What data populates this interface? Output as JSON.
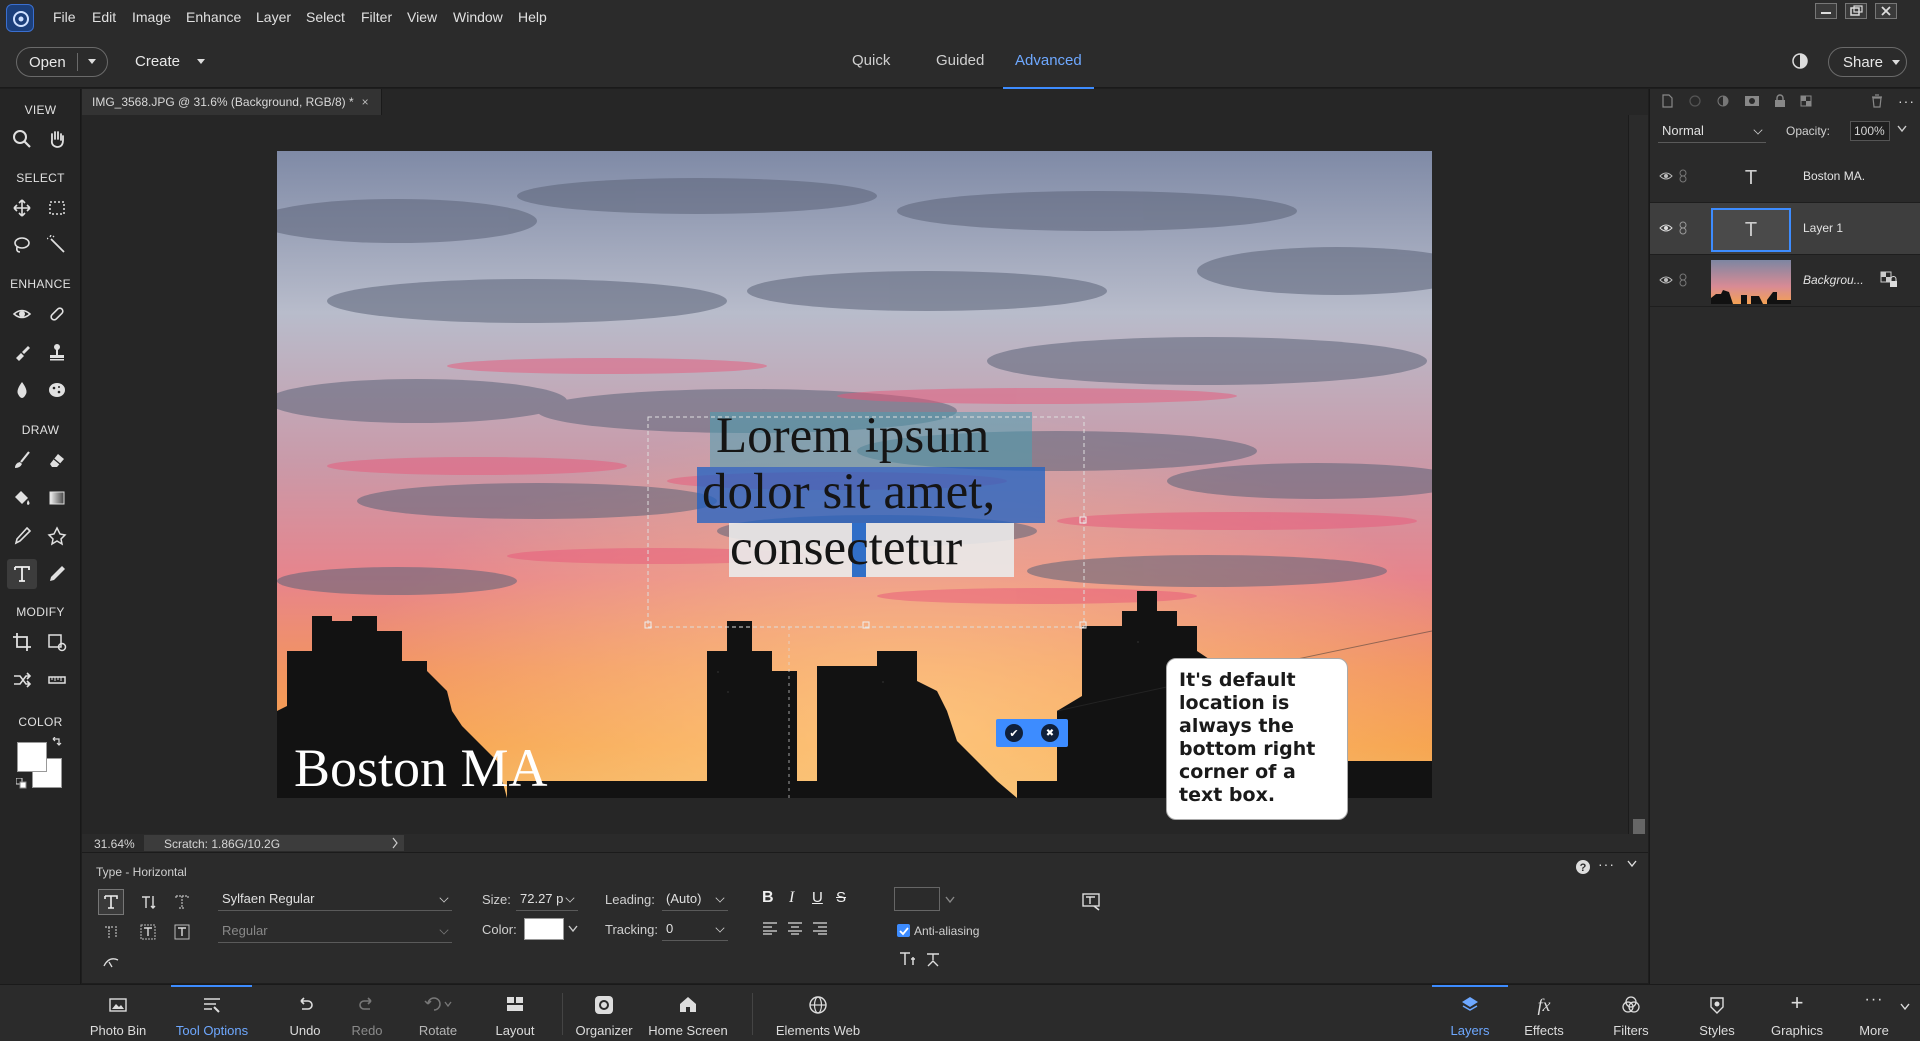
{
  "menubar": {
    "items": [
      "File",
      "Edit",
      "Image",
      "Enhance",
      "Layer",
      "Select",
      "Filter",
      "View",
      "Window",
      "Help"
    ]
  },
  "topbar": {
    "open_label": "Open",
    "create_label": "Create",
    "modes": [
      "Quick",
      "Guided",
      "Advanced"
    ],
    "active_mode": "Advanced",
    "share_label": "Share"
  },
  "document": {
    "tab_title": "IMG_3568.JPG @ 31.6% (Background, RGB/8) *",
    "close_glyph": "×",
    "zoom": "31.64%",
    "scratch": "Scratch: 1.86G/10.2G"
  },
  "toolbar": {
    "sections": [
      "VIEW",
      "SELECT",
      "ENHANCE",
      "DRAW",
      "MODIFY",
      "COLOR"
    ],
    "tools": [
      "zoom-icon",
      "hand-icon",
      "move-icon",
      "marquee-icon",
      "lasso-icon",
      "magic-wand-icon",
      "red-eye-icon",
      "spot-healing-icon",
      "smart-brush-icon",
      "clone-stamp-icon",
      "blur-icon",
      "sponge-icon",
      "brush-icon",
      "eraser-icon",
      "paint-bucket-icon",
      "gradient-icon",
      "eyedropper-icon",
      "custom-shape-icon",
      "type-icon",
      "pencil-icon",
      "crop-icon",
      "recompose-icon",
      "content-aware-move-icon",
      "straighten-icon"
    ],
    "foreground_color": "#ffffff",
    "background_color": "#ffffff"
  },
  "canvas": {
    "text_lines": [
      "Lorem ipsum",
      "dolor sit amet,",
      "consectetur"
    ],
    "boston_text": "Boston MA",
    "commit_glyph": "✔",
    "cancel_glyph": "✖"
  },
  "callout": {
    "text": "It's default location is always the bottom right corner of a text box."
  },
  "layers_panel": {
    "blend_mode": "Normal",
    "opacity_label": "Opacity:",
    "opacity_value": "100%",
    "layers": [
      {
        "name": "Boston MA.",
        "type": "text"
      },
      {
        "name": "Layer 1",
        "type": "text",
        "selected": true
      },
      {
        "name": "Backgrou...",
        "type": "image"
      }
    ],
    "text_thumb_glyph": "T"
  },
  "tool_options": {
    "mode_label": "Type - Horizontal",
    "font_family": "Sylfaen Regular",
    "font_style": "Regular",
    "size_label": "Size:",
    "size_value": "72.27 p",
    "leading_label": "Leading:",
    "leading_value": "(Auto)",
    "color_label": "Color:",
    "color_value": "#ffffff",
    "tracking_label": "Tracking:",
    "tracking_value": "0",
    "style_buttons": [
      "B",
      "I",
      "U",
      "S"
    ],
    "anti_aliasing_label": "Anti-aliasing",
    "anti_aliasing_checked": true,
    "help_glyph": "?"
  },
  "taskbar": {
    "left_items": [
      "Photo Bin",
      "Tool Options",
      "Undo",
      "Redo",
      "Rotate",
      "Layout",
      "Organizer",
      "Home Screen",
      "Elements Web"
    ],
    "right_items": [
      "Layers",
      "Effects",
      "Filters",
      "Styles",
      "Graphics",
      "More"
    ],
    "active_left": "Tool Options",
    "active_right": "Layers",
    "effects_glyph": "fx",
    "graphics_glyph": "+",
    "more_glyph": "···"
  },
  "colors": {
    "accent": "#3d8cff",
    "panel_bg": "#2b2b2b",
    "workspace_bg": "#262626"
  }
}
